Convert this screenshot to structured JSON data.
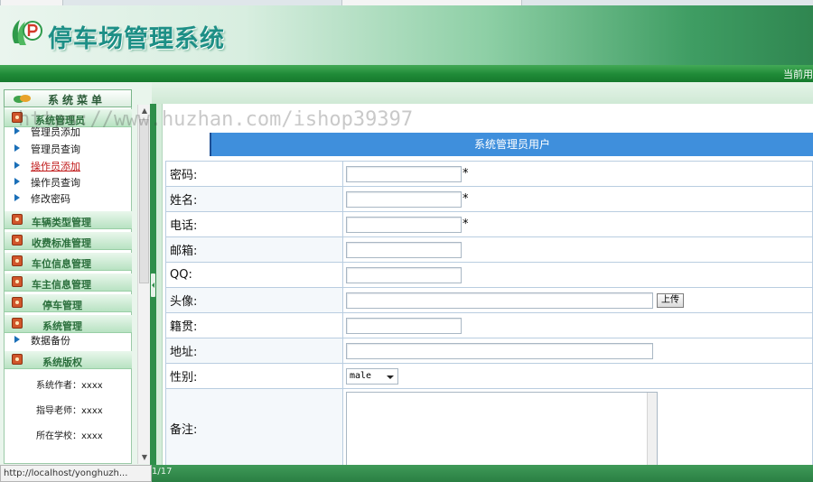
{
  "header": {
    "app_title": "停车场管理系统",
    "current_user_label": "当前用",
    "logo_icon": "parking-p-logo-icon"
  },
  "watermark": "https://www.huzhan.com/ishop39397",
  "sidebar": {
    "menu_title": "系统菜单",
    "groups": [
      {
        "label": "系统管理员",
        "items": [
          "管理员添加",
          "管理员查询",
          "操作员添加",
          "操作员查询",
          "修改密码"
        ],
        "active_item": "操作员添加"
      },
      {
        "label": "车辆类型管理"
      },
      {
        "label": "收费标准管理"
      },
      {
        "label": "车位信息管理"
      },
      {
        "label": "车主信息管理"
      },
      {
        "label": "停车管理"
      },
      {
        "label": "系统管理",
        "items": [
          "数据备份"
        ]
      },
      {
        "label": "系统版权"
      }
    ],
    "info": {
      "author": "系统作者：xxxx",
      "teacher": "指导老师：xxxx",
      "school": "所在学校：xxxx"
    }
  },
  "form": {
    "title": "系统管理员用户",
    "required_mark": "*",
    "fields": [
      {
        "label": "密码:",
        "value": ""
      },
      {
        "label": "姓名:",
        "value": ""
      },
      {
        "label": "电话:",
        "value": ""
      },
      {
        "label": "邮箱:",
        "value": ""
      },
      {
        "label": "QQ:",
        "value": ""
      },
      {
        "label": "头像:",
        "value": ""
      },
      {
        "label": "籍贯:",
        "value": ""
      },
      {
        "label": "地址:",
        "value": ""
      },
      {
        "label": "性别:",
        "value": "male"
      },
      {
        "label": "备注:",
        "value": ""
      }
    ],
    "upload_label": "上传"
  },
  "status": {
    "url": "http://localhost/yonghuzh...",
    "date_fragment": "1/17"
  },
  "colors": {
    "header_green": "#2f8650",
    "nav_green": "#1f8a37",
    "form_title_blue": "#3f8fdc",
    "active_link_red": "#c01818",
    "group_icon_orange": "#d0562b"
  }
}
